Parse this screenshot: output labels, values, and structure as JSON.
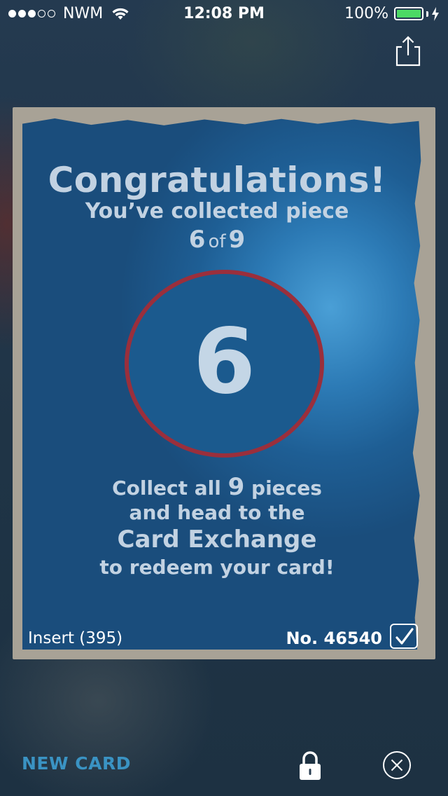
{
  "status_bar": {
    "signal_full": 3,
    "signal_total": 5,
    "carrier": "NWM",
    "time": "12:08 PM",
    "battery_percent": "100%",
    "battery_level": 1.0,
    "battery_color": "#4cd964",
    "icons": [
      "wifi-icon",
      "battery-icon",
      "charging-bolt-icon"
    ]
  },
  "toolbar": {
    "share_icon": "share-icon"
  },
  "card": {
    "headline": "Congratulations!",
    "subtitle": "You’ve collected piece",
    "piece_number": "6",
    "piece_of": "of",
    "piece_total": "9",
    "badge_number": "6",
    "collect_prefix": "Collect all",
    "collect_count": "9",
    "collect_suffix": "pieces",
    "line_two": "and head to the",
    "exchange_name": "Card Exchange",
    "line_four": "to redeem your card!",
    "insert_label": "Insert (395)",
    "serial_number": "No. 46540",
    "verified_icon": "checkbox-checked-icon",
    "colors": {
      "badge_ring": "#9a2f3c",
      "badge_fill": "#1b5a8e",
      "card_blue": "#2c7ab5"
    }
  },
  "bottom_bar": {
    "new_card_label": "NEW CARD",
    "new_card_color": "#3a93c3",
    "lock_icon": "lock-icon",
    "close_icon": "close-circle-icon"
  }
}
